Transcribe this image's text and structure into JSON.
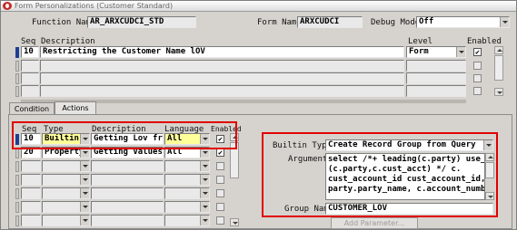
{
  "window": {
    "title": "Form Personalizations (Customer Standard)"
  },
  "header": {
    "function_label": "Function Name",
    "function_value": "AR_ARXCUDCI_STD",
    "form_label": "Form Name",
    "form_value": "ARXCUDCI",
    "debug_label": "Debug Mode",
    "debug_value": "Off"
  },
  "rules": {
    "seq_header": "Seq",
    "desc_header": "Description",
    "level_header": "Level",
    "enabled_header": "Enabled",
    "rows": [
      {
        "seq": "10",
        "description": "Restricting the Customer Name lOV",
        "level": "Form",
        "enabled": "✔"
      }
    ]
  },
  "tabs": {
    "condition": "Condition",
    "actions": "Actions"
  },
  "actions": {
    "seq_header": "Seq",
    "type_header": "Type",
    "desc_header": "Description",
    "lang_header": "Language",
    "enabled_header": "Enabled",
    "rows": [
      {
        "seq": "10",
        "type": "Builtin",
        "description": "Getting Lov from",
        "language": "All",
        "enabled": "✔"
      },
      {
        "seq": "20",
        "type": "Property",
        "description": "Getting Values f",
        "language": "All",
        "enabled": "✔"
      }
    ]
  },
  "builtin": {
    "type_label": "Builtin Type",
    "type_value": "Create Record Group from Query",
    "argument_label": "Argument",
    "argument_value": "select /*+ leading(c.party) use_nl\n(c.party,c.cust_acct) */ c.\ncust_account_id cust_account_id,\nparty.party_name, c.account_number",
    "group_label": "Group Name",
    "group_value": "CUSTOMER_LOV",
    "add_param_label": "Add Parameter..."
  }
}
